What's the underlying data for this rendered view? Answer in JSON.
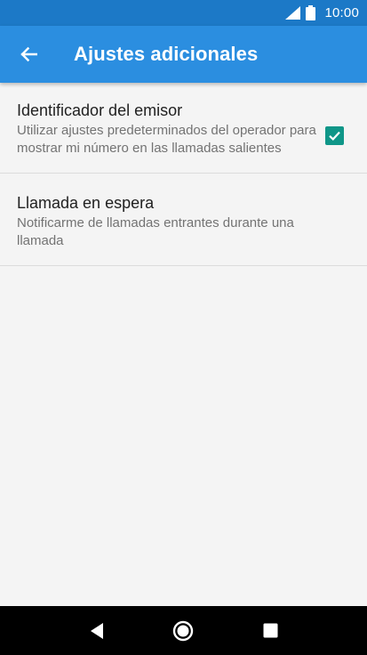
{
  "status_bar": {
    "time": "10:00",
    "signal_icon": "signal-icon",
    "battery_icon": "battery-icon"
  },
  "app_bar": {
    "back_icon": "arrow-left-icon",
    "title": "Ajustes adicionales",
    "color": "#2b8ee0"
  },
  "settings": [
    {
      "title": "Identificador del emisor",
      "summary": "Utilizar ajustes predeterminados del operador para mostrar mi número en las llamadas salientes"
    },
    {
      "title": "Llamada en espera",
      "summary": "Notificarme de llamadas entrantes durante una llamada",
      "checked": true,
      "check_color": "#0f9688"
    }
  ],
  "nav_bar": {
    "back_icon": "triangle-back-icon",
    "home_icon": "circle-home-icon",
    "recents_icon": "square-recents-icon"
  }
}
